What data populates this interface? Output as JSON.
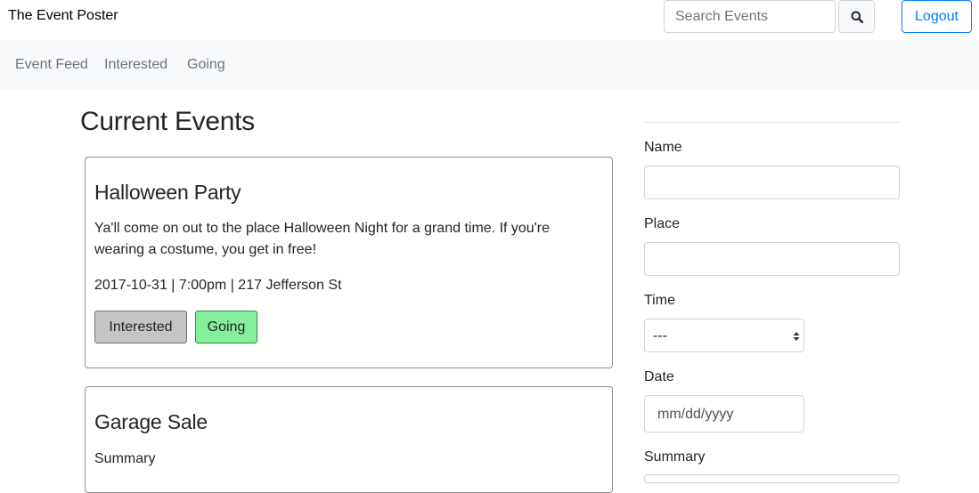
{
  "navbar": {
    "brand": "The Event Poster",
    "search_placeholder": "Search Events",
    "search_icon": "search-icon",
    "logout_label": "Logout"
  },
  "subnav": {
    "items": [
      {
        "label": "Event Feed"
      },
      {
        "label": "Interested"
      },
      {
        "label": "Going"
      }
    ]
  },
  "main": {
    "title": "Current Events",
    "events": [
      {
        "title": "Halloween Party",
        "description": "Ya'll come on out to the place Halloween Night for a grand time. If you're wearing a costume, you get in free!",
        "meta": "2017-10-31 | 7:00pm | 217 Jefferson St",
        "interested_label": "Interested",
        "going_label": "Going"
      },
      {
        "title": "Garage Sale",
        "description": "Summary"
      }
    ]
  },
  "form": {
    "name_label": "Name",
    "place_label": "Place",
    "time_label": "Time",
    "time_value": "---",
    "date_label": "Date",
    "date_placeholder": "mm/dd/yyyy",
    "summary_label": "Summary"
  },
  "colors": {
    "primary": "#007bff",
    "interested_bg": "#c4c4c4",
    "going_bg": "#85ee9a",
    "subnav_bg": "#f8f9fa"
  }
}
